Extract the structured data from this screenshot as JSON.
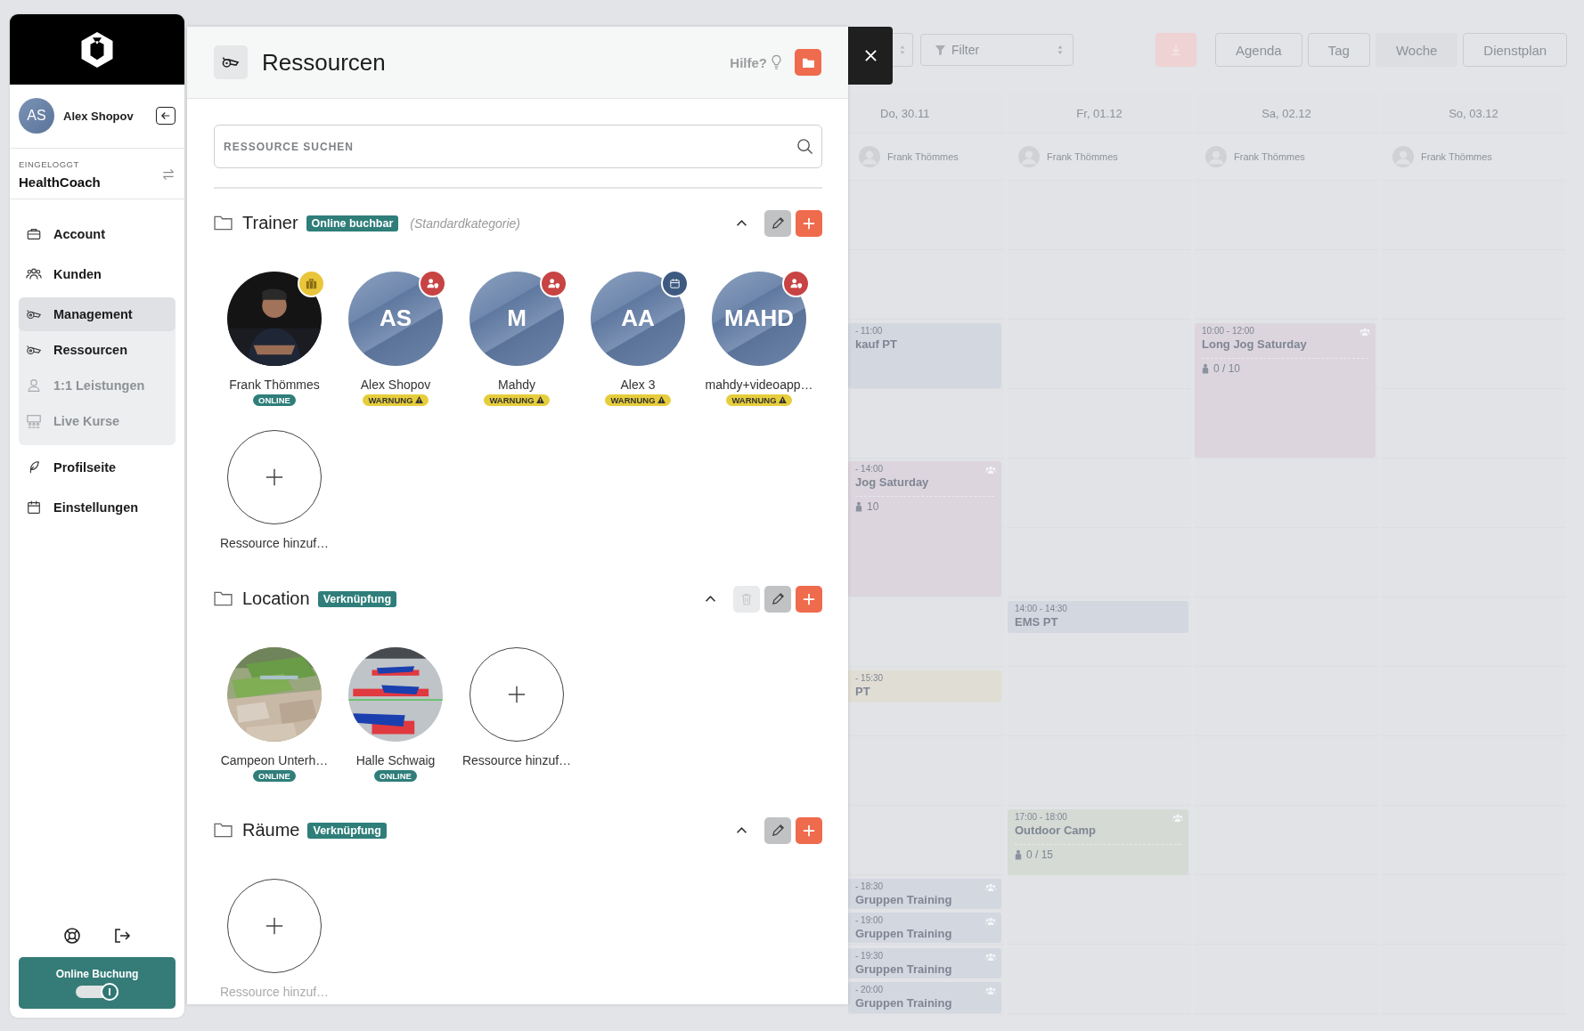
{
  "sidebar": {
    "user": {
      "initials": "AS",
      "name": "Alex Shopov"
    },
    "account_label": "EINGELOGGT",
    "account_name": "HealthCoach",
    "items": [
      {
        "label": "Account",
        "selected": false,
        "disabled": false
      },
      {
        "label": "Kunden",
        "selected": false,
        "disabled": false
      },
      {
        "label": "Management",
        "selected": true,
        "disabled": false,
        "expanded": true,
        "children": [
          {
            "label": "Ressourcen",
            "selected": false,
            "disabled": false
          },
          {
            "label": "1:1 Leistungen",
            "selected": false,
            "disabled": true
          },
          {
            "label": "Live Kurse",
            "selected": false,
            "disabled": true
          }
        ]
      },
      {
        "label": "Profilseite",
        "selected": false,
        "disabled": false
      },
      {
        "label": "Einstellungen",
        "selected": false,
        "disabled": false
      }
    ],
    "online_booking": {
      "label": "Online Buchung",
      "on": true
    }
  },
  "calendar": {
    "filter_placeholder": "Filter",
    "views": [
      {
        "label": "Agenda",
        "selected": false
      },
      {
        "label": "Tag",
        "selected": false
      },
      {
        "label": "Woche",
        "selected": true
      },
      {
        "label": "Dienstplan",
        "selected": false
      }
    ],
    "days": [
      {
        "label": "Do, 30.11",
        "resource": "Frank Thömmes",
        "events": [
          {
            "time": "- 11:00",
            "title": "kauf PT",
            "color": "#d3d7e0",
            "group": false
          },
          {
            "time": "- 14:00",
            "title": "Jog Saturday",
            "count": "10",
            "color": "#dcd5dd",
            "group": true
          },
          {
            "time": "- 15:30",
            "title": "PT",
            "color": "#e0ded4",
            "group": false
          },
          {
            "time": "- 18:30",
            "title": "Gruppen Training",
            "color": "#d3d7e0",
            "group": true
          },
          {
            "time": "- 19:00",
            "title": "Gruppen Training",
            "color": "#d3d7e0",
            "group": true
          },
          {
            "time": "- 19:30",
            "title": "Gruppen Training",
            "color": "#d3d7e0",
            "group": true
          },
          {
            "time": "- 20:00",
            "title": "Gruppen Training",
            "color": "#d3d7e0",
            "group": true
          }
        ]
      },
      {
        "label": "Fr, 01.12",
        "resource": "Frank Thömmes",
        "events": [
          {
            "time": "14:00 - 14:30",
            "title": "EMS PT",
            "color": "#d3d7e0",
            "group": false
          },
          {
            "time": "17:00 - 18:00",
            "title": "Outdoor Camp",
            "count": "0 / 15",
            "color": "#d5dad5",
            "group": true
          }
        ]
      },
      {
        "label": "Sa, 02.12",
        "resource": "Frank Thömmes",
        "events": [
          {
            "time": "10:00 - 12:00",
            "title": "Long Jog Saturday",
            "count": "0 / 10",
            "color": "#dcd5dd",
            "group": true
          }
        ]
      },
      {
        "label": "So, 03.12",
        "resource": "Frank Thömmes"
      }
    ]
  },
  "panel": {
    "title": "Ressourcen",
    "help": "Hilfe?",
    "search_placeholder": "RESSOURCE SUCHEN",
    "categories": [
      {
        "name": "Trainer",
        "tag": "Online buchbar",
        "note": "(Standardkategorie)",
        "expanded": true,
        "deletable": false,
        "add_label": "Ressource hinzuf…",
        "resources": [
          {
            "name": "Frank Thömmes",
            "badge": {
              "kind": "briefcase",
              "color": "#e9c53a"
            },
            "status": {
              "kind": "online",
              "label": "ONLINE"
            }
          },
          {
            "name": "Alex Shopov",
            "kind": "initials",
            "initials": "AS",
            "badge": {
              "kind": "user",
              "color": "#c84343"
            },
            "status": {
              "kind": "warning",
              "label": "WARNUNG"
            }
          },
          {
            "name": "Mahdy",
            "kind": "initials",
            "initials": "M",
            "badge": {
              "kind": "user",
              "color": "#c84343"
            },
            "status": {
              "kind": "warning",
              "label": "WARNUNG"
            }
          },
          {
            "name": "Alex 3",
            "kind": "initials",
            "initials": "AA",
            "badge": {
              "kind": "calendar",
              "color": "#3e5a80"
            },
            "status": {
              "kind": "warning",
              "label": "WARNUNG"
            }
          },
          {
            "name": "mahdy+videoapp…",
            "kind": "initials",
            "initials": "MAHD",
            "badge": {
              "kind": "user",
              "color": "#c84343"
            },
            "status": {
              "kind": "warning",
              "label": "WARNUNG"
            }
          }
        ]
      },
      {
        "name": "Location",
        "tag": "Verknüpfung",
        "expanded": true,
        "deletable": true,
        "add_label": "Ressource hinzuf…",
        "resources": [
          {
            "name": "Campeon Unterh…",
            "status": {
              "kind": "online",
              "label": "ONLINE"
            }
          },
          {
            "name": "Halle Schwaig",
            "status": {
              "kind": "online",
              "label": "ONLINE"
            }
          }
        ]
      },
      {
        "name": "Räume",
        "tag": "Verknüpfung",
        "expanded": true,
        "deletable": false,
        "add_label": "Ressource hinzuf…"
      }
    ]
  }
}
